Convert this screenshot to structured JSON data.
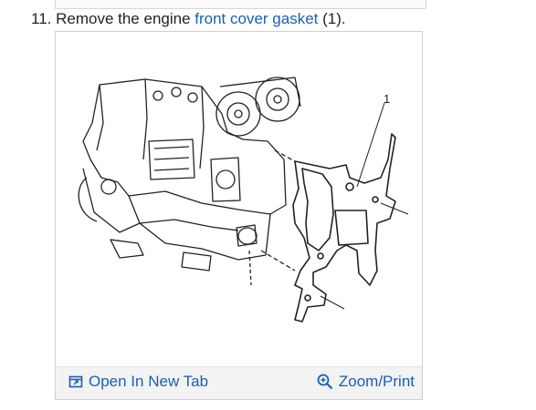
{
  "step": {
    "number": "11.",
    "text_before": "Remove the engine ",
    "link_text": "front cover gasket",
    "text_after": " (1)."
  },
  "figure": {
    "callout_label": "1",
    "open_tab_label": "Open In New Tab",
    "zoom_label": "Zoom/Print",
    "open_tab_icon": "open-new-tab-icon",
    "zoom_icon": "zoom-in-icon"
  },
  "colors": {
    "link": "#1a5fb4",
    "bar_bg": "#f3f3f3",
    "border": "#d0d0d0"
  }
}
